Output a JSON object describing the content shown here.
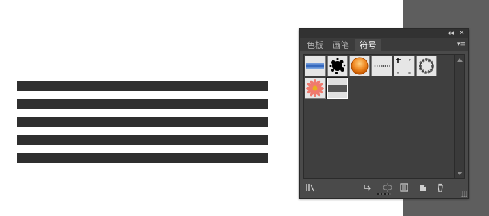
{
  "panel": {
    "title_controls": {
      "collapse": "◂◂",
      "close": "✕"
    },
    "tabs": [
      {
        "label": "色板",
        "active": false
      },
      {
        "label": "画笔",
        "active": false
      },
      {
        "label": "符号",
        "active": true
      }
    ],
    "panel_menu_icon": "panel-menu-icon",
    "symbols": [
      {
        "name": "blue-gradient-bar-symbol",
        "selected": false
      },
      {
        "name": "black-splatter-symbol",
        "selected": false
      },
      {
        "name": "orange-button-symbol",
        "selected": false
      },
      {
        "name": "dotted-line-symbol",
        "selected": false
      },
      {
        "name": "corner-marks-symbol",
        "selected": false
      },
      {
        "name": "chain-ring-symbol",
        "selected": false
      },
      {
        "name": "pink-flower-symbol",
        "selected": false
      },
      {
        "name": "gray-band-symbol",
        "selected": true
      }
    ],
    "bottom_icons": [
      "symbol-libraries-icon",
      "place-symbol-instance-icon",
      "break-link-icon",
      "symbol-options-icon",
      "new-symbol-icon",
      "delete-symbol-icon"
    ]
  },
  "colors": {
    "panel_bg": "#4a4a4a",
    "artboard_stripe": "#2f2f2f",
    "pasteboard": "#5e5e5e",
    "orange_button": "#f08a24"
  }
}
